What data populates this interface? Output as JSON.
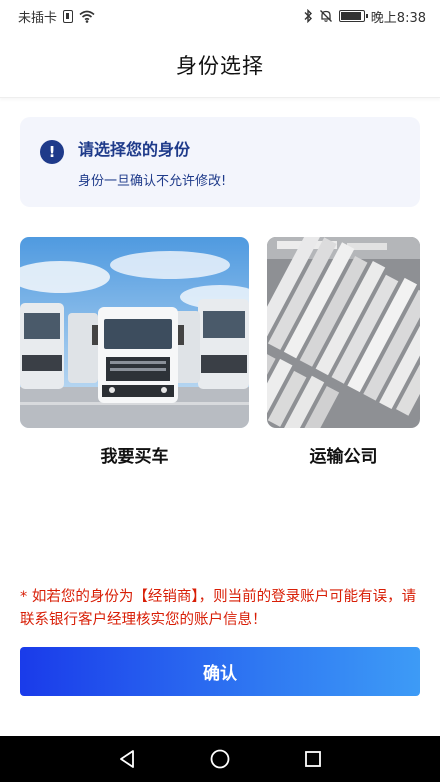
{
  "status_bar": {
    "carrier": "未插卡",
    "time": "晚上8:38",
    "battery_level": 0.9,
    "icons": [
      "sim-icon",
      "wifi-icon",
      "bluetooth-icon",
      "mute-icon",
      "battery-icon"
    ]
  },
  "header": {
    "title": "身份选择"
  },
  "notice": {
    "icon": "exclamation-icon",
    "title": "请选择您的身份",
    "subtitle": "身份一旦确认不允许修改!"
  },
  "roles": [
    {
      "label": "我要买车",
      "image": "trucks-photo"
    },
    {
      "label": "运输公司",
      "image": "truck-parking-lot-photo"
    }
  ],
  "warning": "* 如若您的身份为【经销商】，则当前的登录账户可能有误，请联系银行客户经理核实您的账户信息！",
  "confirm_label": "确认",
  "android_nav": [
    "back-icon",
    "home-icon",
    "recents-icon"
  ],
  "colors": {
    "accent": "#1e3a8a",
    "warning": "#d81e06",
    "button_start": "#1a3bea",
    "button_end": "#3d9bf6",
    "notice_bg": "#f3f5fc"
  }
}
